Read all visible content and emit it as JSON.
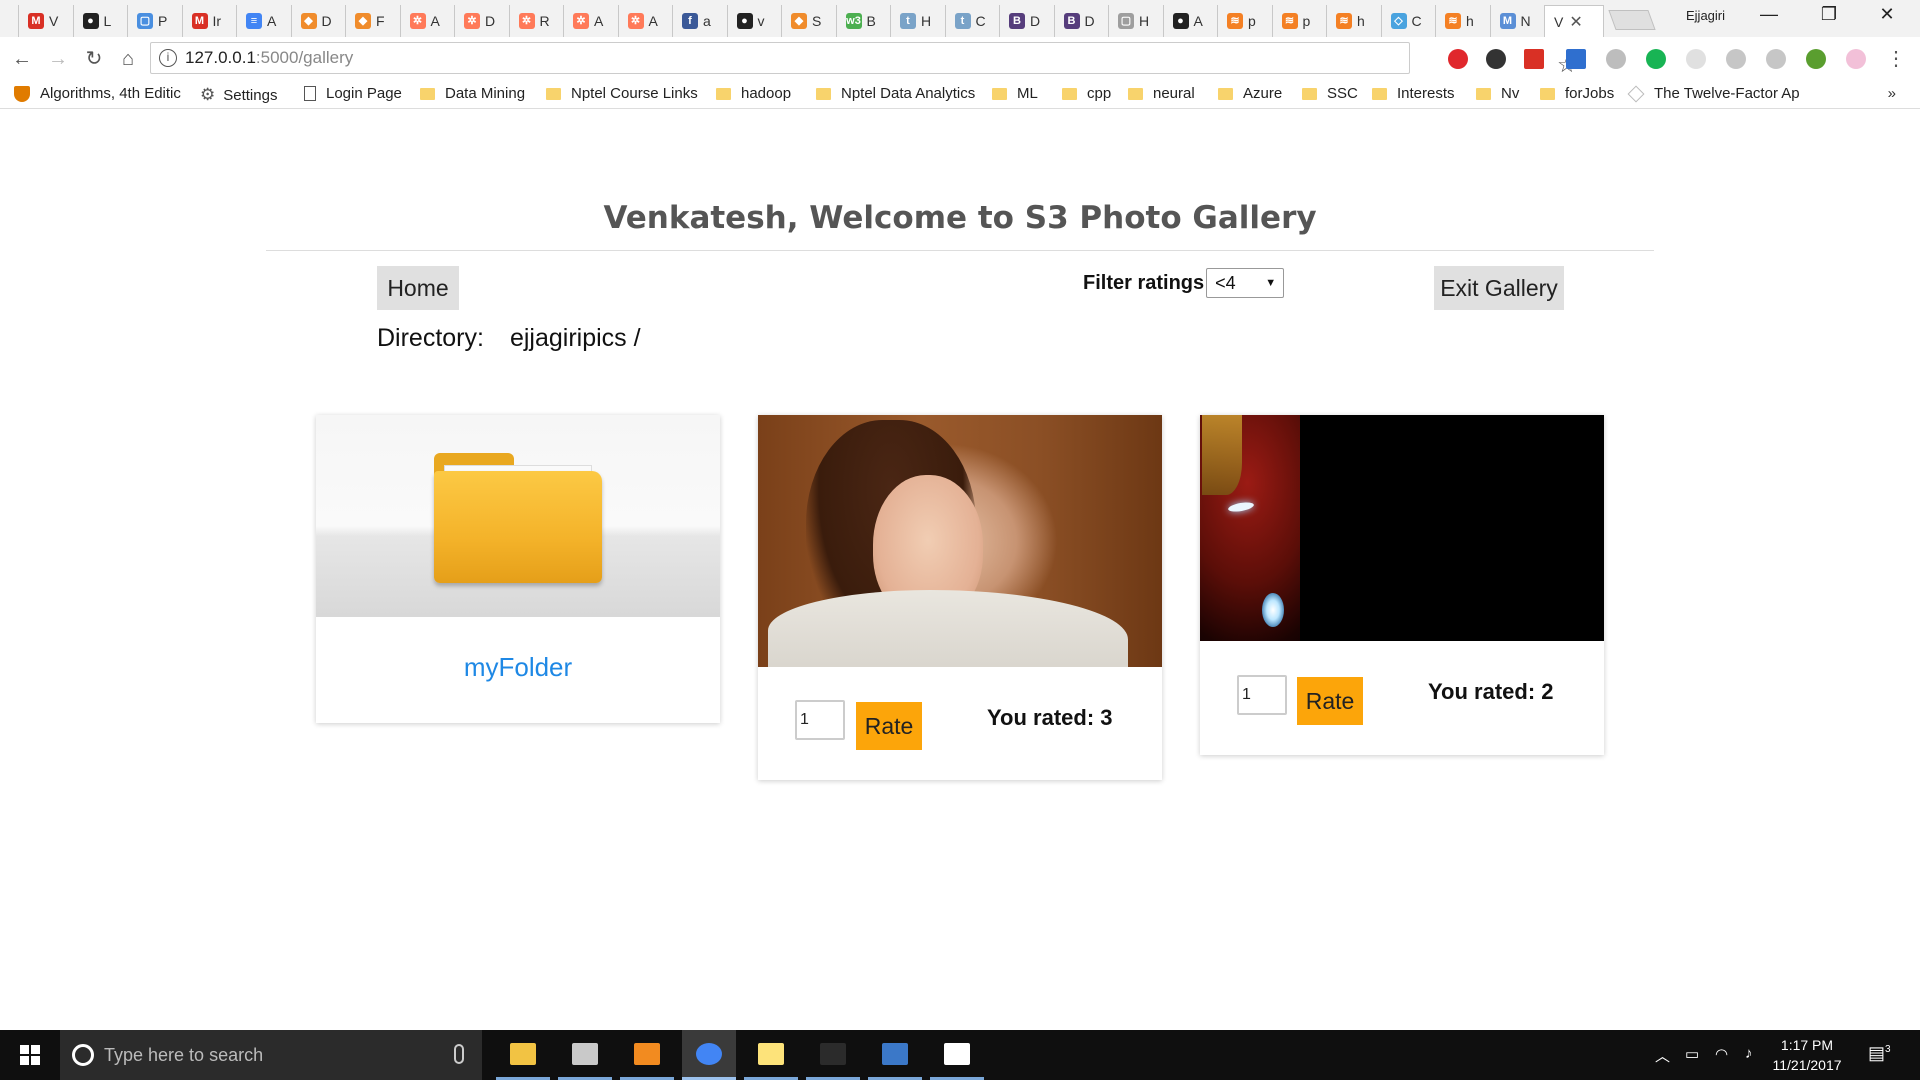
{
  "browser": {
    "tabs": [
      {
        "fav": "gmail-icon",
        "color": "#d93025",
        "glyph": "M",
        "title": "V"
      },
      {
        "fav": "github-icon",
        "color": "#222222",
        "glyph": "●",
        "title": "L"
      },
      {
        "fav": "page-icon",
        "color": "#4a8fe0",
        "glyph": "▢",
        "title": "P"
      },
      {
        "fav": "gmail-icon",
        "color": "#d93025",
        "glyph": "M",
        "title": "Ir"
      },
      {
        "fav": "docs-icon",
        "color": "#4285f4",
        "glyph": "≡",
        "title": "A"
      },
      {
        "fav": "cube-icon",
        "color": "#f08c2c",
        "glyph": "◆",
        "title": "D"
      },
      {
        "fav": "cube-icon",
        "color": "#f08c2c",
        "glyph": "◆",
        "title": "F"
      },
      {
        "fav": "hubspot-icon",
        "color": "#ff7a59",
        "glyph": "✲",
        "title": "A"
      },
      {
        "fav": "hubspot-icon",
        "color": "#ff7a59",
        "glyph": "✲",
        "title": "D"
      },
      {
        "fav": "hubspot-icon",
        "color": "#ff7a59",
        "glyph": "✲",
        "title": "R"
      },
      {
        "fav": "hubspot-icon",
        "color": "#ff7a59",
        "glyph": "✲",
        "title": "A"
      },
      {
        "fav": "hubspot-icon",
        "color": "#ff7a59",
        "glyph": "✲",
        "title": "A"
      },
      {
        "fav": "facebook-icon",
        "color": "#3b5998",
        "glyph": "f",
        "title": "a"
      },
      {
        "fav": "github-icon",
        "color": "#222222",
        "glyph": "●",
        "title": "v"
      },
      {
        "fav": "cube-icon",
        "color": "#f08c2c",
        "glyph": "◆",
        "title": "S"
      },
      {
        "fav": "w3-icon",
        "color": "#4caf50",
        "glyph": "w3",
        "title": "B"
      },
      {
        "fav": "tumblr-icon",
        "color": "#7aa3c8",
        "glyph": "t",
        "title": "H"
      },
      {
        "fav": "tumblr-icon",
        "color": "#7aa3c8",
        "glyph": "t",
        "title": "C"
      },
      {
        "fav": "bootstrap-icon",
        "color": "#563d7c",
        "glyph": "B",
        "title": "D"
      },
      {
        "fav": "bootstrap-icon",
        "color": "#563d7c",
        "glyph": "B",
        "title": "D"
      },
      {
        "fav": "page-icon",
        "color": "#9e9e9e",
        "glyph": "▢",
        "title": "H"
      },
      {
        "fav": "github-icon",
        "color": "#222222",
        "glyph": "●",
        "title": "A"
      },
      {
        "fav": "stackoverflow-icon",
        "color": "#f48024",
        "glyph": "≋",
        "title": "p"
      },
      {
        "fav": "stackoverflow-icon",
        "color": "#f48024",
        "glyph": "≋",
        "title": "p"
      },
      {
        "fav": "stackoverflow-icon",
        "color": "#f48024",
        "glyph": "≋",
        "title": "h"
      },
      {
        "fav": "code-icon",
        "color": "#4aa3df",
        "glyph": "◇",
        "title": "C"
      },
      {
        "fav": "stackoverflow-icon",
        "color": "#f48024",
        "glyph": "≋",
        "title": "h"
      },
      {
        "fav": "msdn-icon",
        "color": "#5b8fd6",
        "glyph": "M",
        "title": "N"
      },
      {
        "fav": "",
        "color": "#ffffff",
        "glyph": "",
        "title": "V",
        "active": true
      }
    ],
    "profile": "Ejjagiri",
    "window_controls": {
      "minimize": "—",
      "restore": "❐",
      "close": "✕"
    },
    "url_host": "127.0.0.1",
    "url_path": ":5000/gallery",
    "bookmarks": [
      {
        "icon": "crest",
        "label": "Algorithms, 4th Editic"
      },
      {
        "icon": "gear",
        "label": "Settings"
      },
      {
        "icon": "page",
        "label": "Login Page"
      },
      {
        "icon": "folder",
        "label": "Data Mining"
      },
      {
        "icon": "folder",
        "label": "Nptel Course Links"
      },
      {
        "icon": "folder",
        "label": "hadoop"
      },
      {
        "icon": "folder",
        "label": "Nptel Data Analytics"
      },
      {
        "icon": "folder",
        "label": "ML"
      },
      {
        "icon": "folder",
        "label": "cpp"
      },
      {
        "icon": "folder",
        "label": "neural"
      },
      {
        "icon": "folder",
        "label": "Azure"
      },
      {
        "icon": "folder",
        "label": "SSC"
      },
      {
        "icon": "folder",
        "label": "Interests"
      },
      {
        "icon": "folder",
        "label": "Nv"
      },
      {
        "icon": "folder",
        "label": "forJobs"
      },
      {
        "icon": "diamond",
        "label": "The Twelve-Factor Ap"
      }
    ],
    "bookmarks_more": "»"
  },
  "gallery": {
    "title": "Venkatesh, Welcome to S3 Photo Gallery",
    "home_button": "Home",
    "filter_label": "Filter ratings",
    "filter_value": "<4",
    "exit_button": "Exit Gallery",
    "directory_label": "Directory:",
    "directory_value": "ejjagiripics /",
    "cards": [
      {
        "type": "folder",
        "name": "myFolder"
      },
      {
        "type": "photo",
        "image": "woman-smiling-photo",
        "input_value": "1",
        "rate_label": "Rate",
        "rated_text": "You rated: 3"
      },
      {
        "type": "photo",
        "image": "iron-man-photo",
        "input_value": "1",
        "rate_label": "Rate",
        "rated_text": "You rated: 2"
      }
    ],
    "accent_color": "#fca50a",
    "link_color": "#1e88e5"
  },
  "taskbar": {
    "search_placeholder": "Type here to search",
    "apps": [
      {
        "name": "file-explorer",
        "color": "#f2c343",
        "running": true
      },
      {
        "name": "paint",
        "color": "#c9c9c9",
        "running": true
      },
      {
        "name": "sublime-text",
        "color": "#f28b20",
        "running": true
      },
      {
        "name": "chrome",
        "color": "#4285f4",
        "active": true
      },
      {
        "name": "sticky-notes",
        "color": "#fde37a",
        "running": true
      },
      {
        "name": "command-prompt",
        "color": "#2b2b2b",
        "running": true
      },
      {
        "name": "generic-app",
        "color": "#3b78c8",
        "running": true
      },
      {
        "name": "photos",
        "color": "#ffffff",
        "running": true
      }
    ],
    "time": "1:17 PM",
    "date": "11/21/2017",
    "notification_count": "3"
  }
}
